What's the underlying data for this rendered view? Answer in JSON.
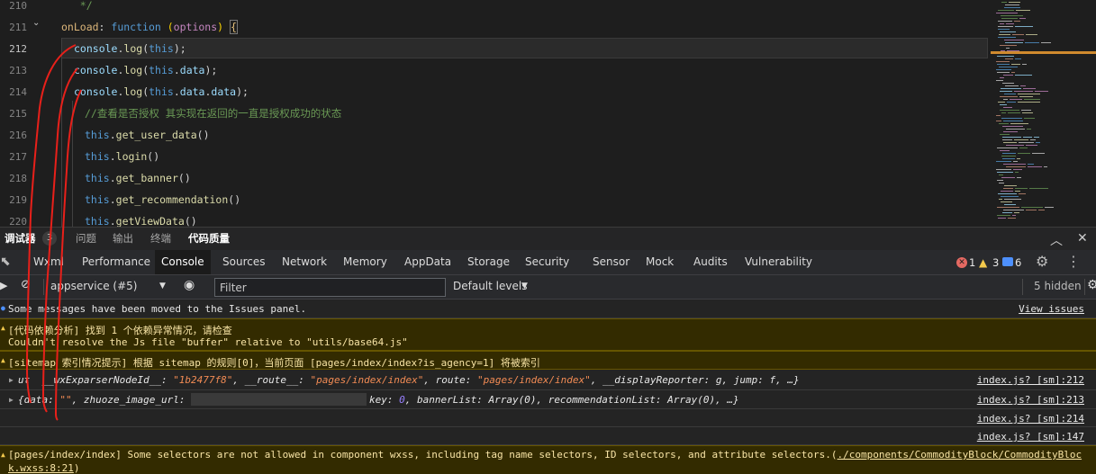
{
  "editor": {
    "lines": [
      {
        "n": "210",
        "text": "   */"
      },
      {
        "n": "211",
        "text": "onLoad: function (options) {"
      },
      {
        "n": "212",
        "text": "console.log(this);"
      },
      {
        "n": "213",
        "text": "console.log(this.data);"
      },
      {
        "n": "214",
        "text": "console.log(this.data.data);"
      },
      {
        "n": "215",
        "text": "//查看是否授权 其实现在返回的一直是授权成功的状态"
      },
      {
        "n": "216",
        "text": "this.get_user_data()"
      },
      {
        "n": "217",
        "text": "this.login()"
      },
      {
        "n": "218",
        "text": "this.get_banner()"
      },
      {
        "n": "219",
        "text": "this.get_recommendation()"
      },
      {
        "n": "220",
        "text": "this.getViewData()"
      }
    ]
  },
  "panel_tabs": {
    "debugger": "调试器",
    "debugger_count": "3",
    "problems": "问题",
    "output": "输出",
    "terminal": "终端",
    "code_quality": "代码质量"
  },
  "devtools_tabs": [
    "Wxml",
    "Performance",
    "Console",
    "Sources",
    "Network",
    "Memory",
    "AppData",
    "Storage",
    "Security",
    "Sensor",
    "Mock",
    "Audits",
    "Vulnerability"
  ],
  "counts": {
    "errors": "1",
    "warnings": "3",
    "messages": "6"
  },
  "toolbar": {
    "context": "appservice (#5)",
    "filter_placeholder": "Filter",
    "levels": "Default levels",
    "hidden": "5 hidden"
  },
  "console": {
    "issues_msg": "Some messages have been moved to the Issues panel.",
    "issues_link": "View issues",
    "warn1_line1": "[代码依赖分析] 找到 1 个依赖异常情况，请检查",
    "warn1_line2": "Couldn't resolve the Js file \"buffer\" relative to \"utils/base64.js\"",
    "warn2": "[sitemap 索引情况提示] 根据 sitemap 的规则[0]，当前页面 [pages/index/index?is_agency=1] 将被索引",
    "log1_a": "ut  __wxExparserNodeId__: ",
    "log1_b": "\"1b2477f8\"",
    "log1_c": ", __route__: ",
    "log1_d": "\"pages/index/index\"",
    "log1_e": ", route: ",
    "log1_f": "\"pages/index/index\"",
    "log1_g": ", __displayReporter: g, jump: f, …}",
    "log1_src": "index.js? [sm]:212",
    "log2_a": "{data: ",
    "log2_b": "\"\"",
    "log2_c": ", zhuoze_image_url: ",
    "log2_d": "key: ",
    "log2_e": "0",
    "log2_f": ", bannerList: Array(0), recommendationList: Array(0), …}",
    "log2_src": "index.js? [sm]:213",
    "log3_src": "index.js? [sm]:214",
    "log4_src": "index.js? [sm]:147",
    "warn3_line1_a": "[pages/index/index] Some selectors are not allowed in component wxss, including tag name selectors, ID selectors, and attribute selectors.(",
    "warn3_line1_b": "./components/CommodityBlock/CommodityBloc",
    "warn3_line2": "k.wxss:8:21",
    "warn3_line2_end": ")"
  }
}
